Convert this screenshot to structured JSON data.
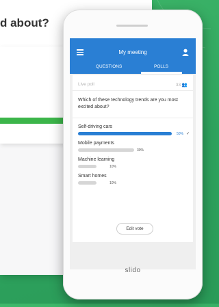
{
  "background": {
    "color": "#33ad62"
  },
  "desktop": {
    "question_fragment": "d about?",
    "bar_fill_fraction": 0.5,
    "bar_color": "#3cb54a"
  },
  "phone": {
    "brand": "slido",
    "app_bar": {
      "title": "My meeting",
      "color": "#2a7fd4",
      "icons": [
        "menu-icon",
        "user-icon"
      ],
      "tabs": [
        {
          "label": "QUESTIONS",
          "active": false
        },
        {
          "label": "POLLS",
          "active": true
        }
      ]
    },
    "poll": {
      "status": "Live poll",
      "participant_count": "33",
      "question": "Which of these technology trends are you most excited about?",
      "options": [
        {
          "label": "Self-driving cars",
          "percent": "50%",
          "value": 50,
          "selected": true
        },
        {
          "label": "Mobile payments",
          "percent": "30%",
          "value": 30,
          "selected": false
        },
        {
          "label": "Machine learning",
          "percent": "10%",
          "value": 10,
          "selected": false
        },
        {
          "label": "Smart homes",
          "percent": "10%",
          "value": 10,
          "selected": false
        }
      ],
      "edit_vote_label": "Edit vote"
    }
  }
}
